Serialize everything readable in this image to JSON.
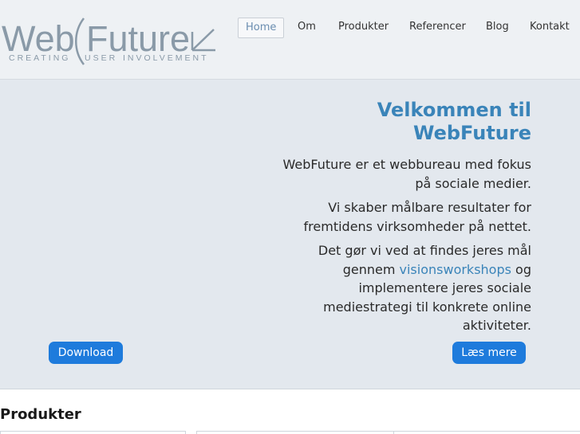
{
  "logo": {
    "word_web": "Web",
    "word_future": "Future",
    "tagline_creating": "CREATING",
    "tagline_user": "USER",
    "tagline_involvement": "INVOLVEMENT",
    "color": "#8a9aa8"
  },
  "nav": {
    "items": [
      {
        "label": "Home"
      },
      {
        "label": "Om"
      },
      {
        "label": "Produkter"
      },
      {
        "label": "Referencer"
      },
      {
        "label": "Blog"
      },
      {
        "label": "Kontakt"
      }
    ]
  },
  "hero": {
    "title": "Velkommen til WebFuture",
    "paragraph1": "WebFuture er et webbureau med fokus på sociale medier.",
    "paragraph2": "Vi skaber målbare resultater for fremtidens virksomheder på nettet.",
    "paragraph3_before": "Det gør vi ved at findes jeres mål gennem",
    "paragraph3_link": "visionsworkshops",
    "paragraph3_after": "og implementere jeres sociale mediestrategi til konkrete online aktiviteter.",
    "download_label": "Download",
    "read_more_label": "Læs mere"
  },
  "products": {
    "title": "Produkter"
  },
  "colors": {
    "accent": "#3a84b9",
    "button": "#1e7bdc",
    "header_bg": "#eef1f4",
    "hero_bg": "#e3e8ee"
  }
}
